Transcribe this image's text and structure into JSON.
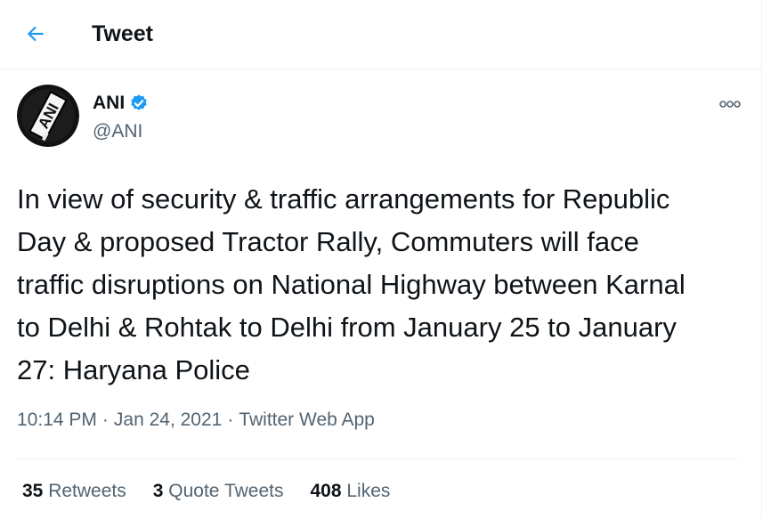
{
  "header": {
    "title": "Tweet",
    "back_icon": "arrow-left-icon"
  },
  "author": {
    "display_name": "ANI",
    "handle": "@ANI",
    "verified": true,
    "avatar_text": "ANI"
  },
  "tweet": {
    "text": "In view of security & traffic arrangements for Republic\nDay & proposed Tractor Rally, Commuters will face\ntraffic disruptions on National Highway between Karnal\nto Delhi & Rohtak to Delhi from January 25 to January\n27: Haryana Police",
    "time": "10:14 PM",
    "date": "Jan 24, 2021",
    "source": "Twitter Web App",
    "separator": "·"
  },
  "stats": {
    "retweets_count": "35",
    "retweets_label": "Retweets",
    "quotes_count": "3",
    "quotes_label": "Quote Tweets",
    "likes_count": "408",
    "likes_label": "Likes"
  },
  "colors": {
    "accent": "#1d9bf0",
    "text_primary": "#0f1419",
    "text_secondary": "#536471",
    "border": "#eff3f4"
  }
}
